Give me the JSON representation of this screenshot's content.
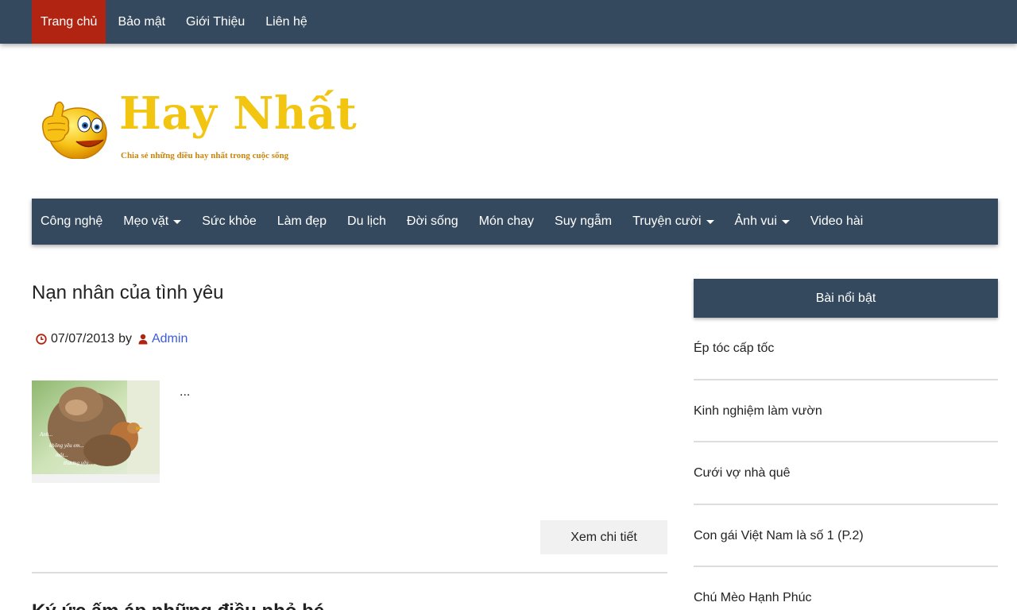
{
  "top_nav": [
    "Trang chủ",
    "Bảo mật",
    "Giới Thiệu",
    "Liên hệ"
  ],
  "logo": {
    "title": "Hay Nhất",
    "subtitle": "Chia sẻ những điều hay nhất trong cuộc sống",
    "icon": "thumbs-up-smiley-icon"
  },
  "main_nav": [
    {
      "label": "Công nghệ",
      "dropdown": false
    },
    {
      "label": "Mẹo vặt",
      "dropdown": true
    },
    {
      "label": "Sức khỏe",
      "dropdown": false
    },
    {
      "label": "Làm đẹp",
      "dropdown": false
    },
    {
      "label": "Du lịch",
      "dropdown": false
    },
    {
      "label": "Đời sống",
      "dropdown": false
    },
    {
      "label": "Món chay",
      "dropdown": false
    },
    {
      "label": "Suy ngẫm",
      "dropdown": false
    },
    {
      "label": "Truyện cười",
      "dropdown": true
    },
    {
      "label": "Ảnh vui",
      "dropdown": true
    },
    {
      "label": "Video hài",
      "dropdown": false
    }
  ],
  "article": {
    "title": "Nạn nhân của tình yêu",
    "date": "07/07/2013",
    "by": "by",
    "author": "Admin",
    "excerpt": "...",
    "more_label": "Xem chi tiết",
    "next_title_partial": "Ký ức ấm áp những điều nhỏ bé"
  },
  "sidebar": {
    "heading": "Bài nổi bật",
    "items": [
      "Ép tóc cấp tốc",
      "Kinh nghiệm làm vườn",
      "Cưới vợ nhà quê",
      "Con gái Việt Nam là số 1 (P.2)",
      "Chú Mèo Hạnh Phúc"
    ]
  },
  "colors": {
    "nav_bg": "#34495e",
    "active_bg": "#b22412",
    "logo_yellow": "#f2c510",
    "link_blue": "#3a5bd9",
    "icon_red": "#b22412"
  }
}
